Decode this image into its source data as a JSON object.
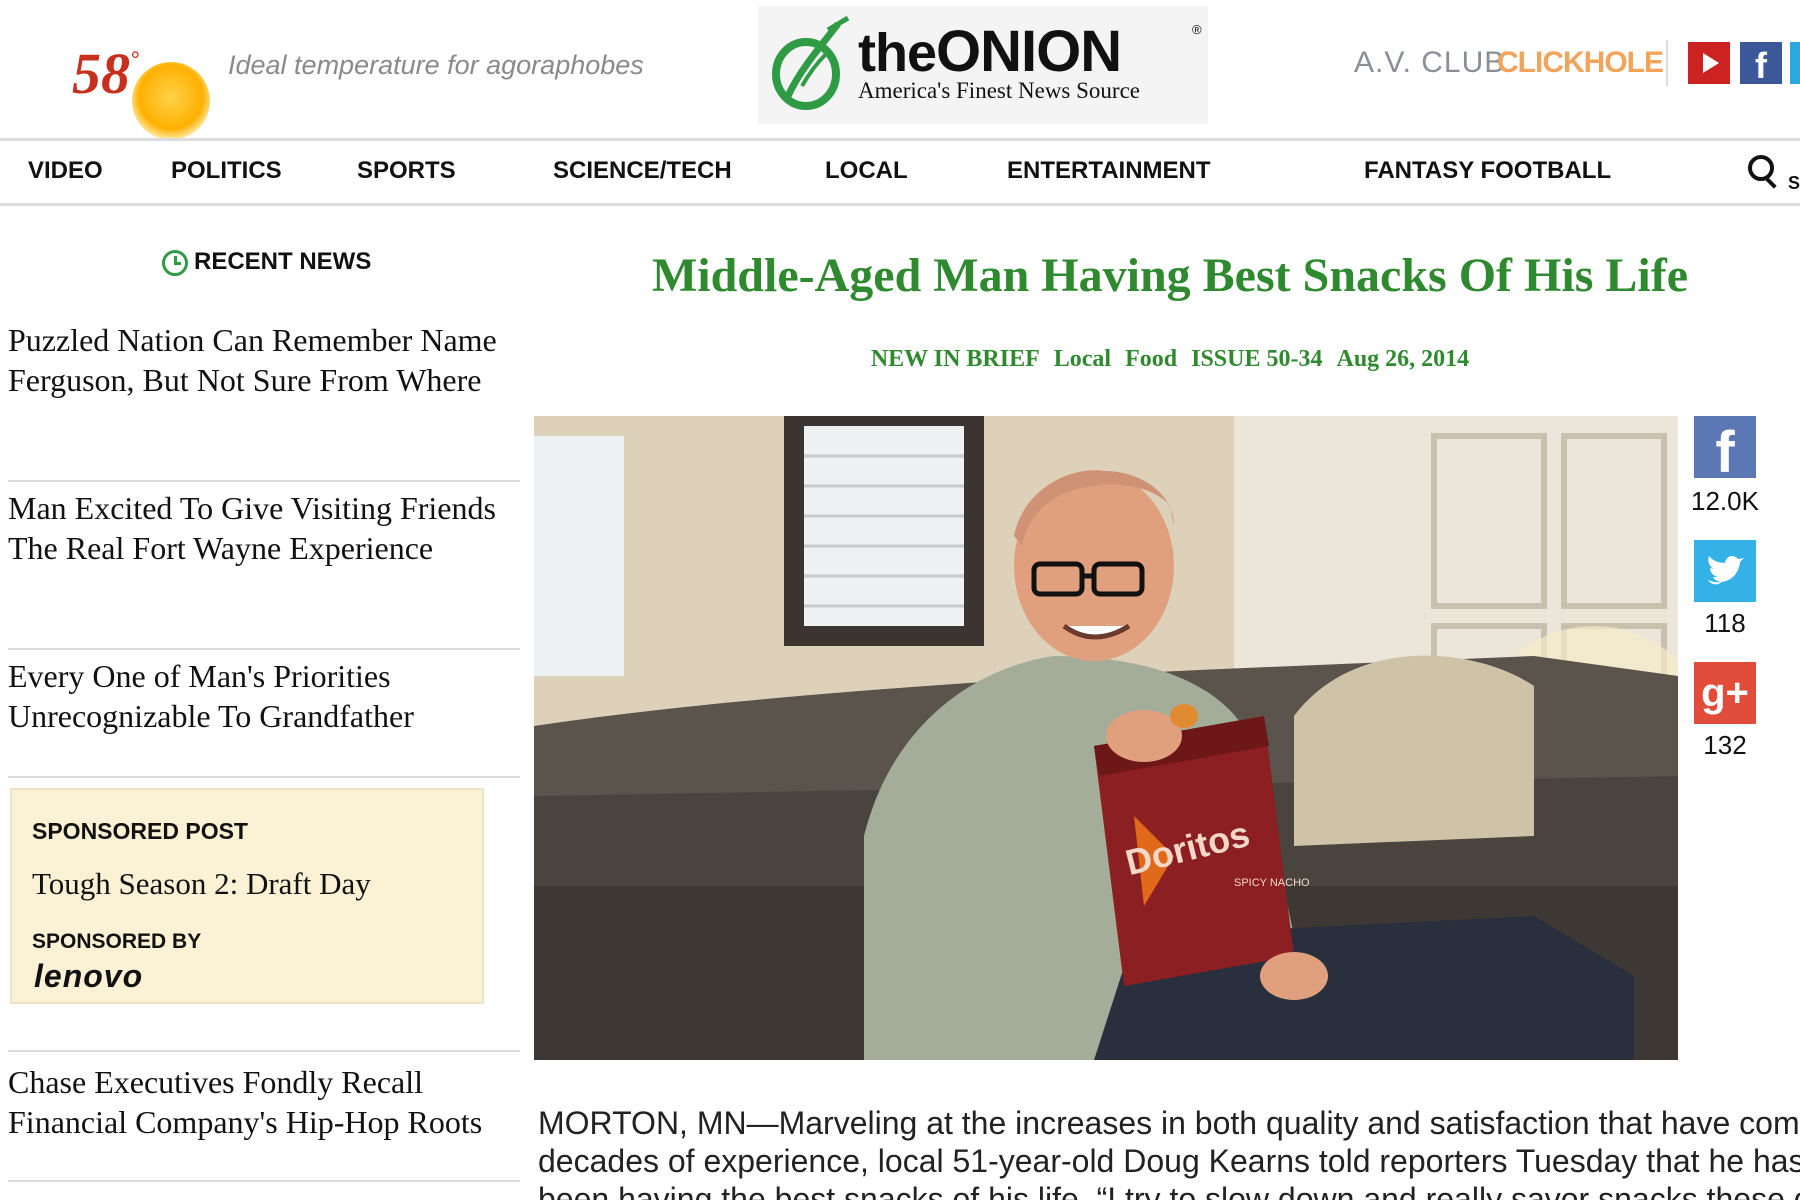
{
  "header": {
    "temperature": "58",
    "degree": "°",
    "temperature_tagline": "Ideal temperature for agoraphobes",
    "logo_the": "the",
    "logo_name": "ONION",
    "logo_reg": "®",
    "logo_tagline": "America's Finest News Source",
    "partner_links": [
      "A.V. CLUB",
      "CLICKHOLE"
    ],
    "social_icons": [
      "youtube-icon",
      "facebook-icon",
      "twitter-icon"
    ]
  },
  "nav": {
    "items": [
      "VIDEO",
      "POLITICS",
      "SPORTS",
      "SCIENCE/TECH",
      "LOCAL",
      "ENTERTAINMENT",
      "FANTASY FOOTBALL"
    ],
    "search_label": "S"
  },
  "sidebar": {
    "heading": "RECENT NEWS",
    "stories": [
      "Puzzled Nation Can Remember Name Ferguson, But Not Sure From Where",
      "Man Excited To Give Visiting Friends The Real Fort Wayne Experience",
      "Every One of Man's Priorities Unrecognizable To Grandfather",
      "Chase Executives Fondly Recall Financial Company's Hip-Hop Roots"
    ],
    "sponsored": {
      "label": "SPONSORED POST",
      "title": "Tough Season 2: Draft Day",
      "by_label": "SPONSORED BY",
      "brand": "lenovo"
    }
  },
  "article": {
    "headline": "Middle-Aged Man Having Best Snacks Of His Life",
    "meta": [
      "NEW IN BRIEF",
      "Local",
      "Food",
      "ISSUE 50-34",
      "Aug 26, 2014"
    ],
    "bag_label": "Doritos",
    "bag_sub": "SPICY NACHO",
    "lead_lines": [
      "MORTON, MN—Marveling at the increases in both quality and satisfaction that have com",
      "decades of experience, local 51-year-old Doug Kearns told reporters Tuesday that he has",
      "been having the best snacks of his life. “I try to slow down and really savor snacks these d"
    ]
  },
  "share": {
    "facebook_count": "12.0K",
    "twitter_count": "118",
    "googleplus_count": "132"
  },
  "colors": {
    "accent_green": "#2f8a2f",
    "temp_red": "#c8301e",
    "sponsor_bg": "#fbf2d6"
  }
}
